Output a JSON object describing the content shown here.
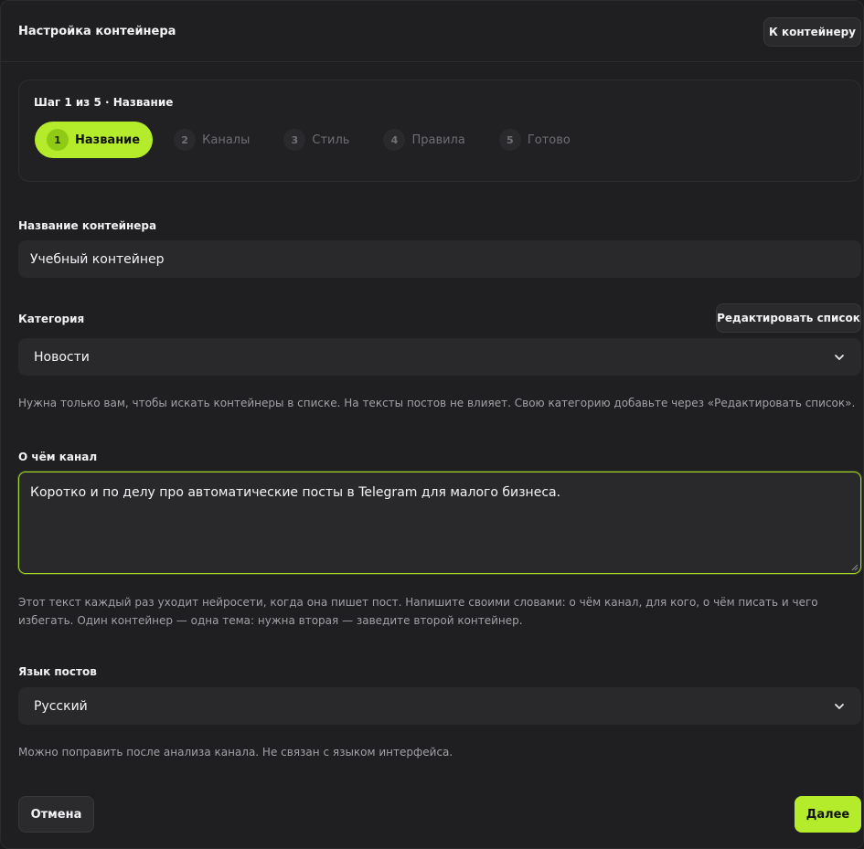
{
  "header": {
    "title": "Настройка контейнера",
    "back_button": "К контейнеру"
  },
  "stepper": {
    "title": "Шаг 1 из 5 · Название",
    "steps": [
      {
        "num": "1",
        "label": "Название"
      },
      {
        "num": "2",
        "label": "Каналы"
      },
      {
        "num": "3",
        "label": "Стиль"
      },
      {
        "num": "4",
        "label": "Правила"
      },
      {
        "num": "5",
        "label": "Готово"
      }
    ],
    "active_step": 1
  },
  "name_field": {
    "label": "Название контейнера",
    "value": "Учебный контейнер"
  },
  "category": {
    "label": "Категория",
    "edit_button": "Редактировать список",
    "selected": "Новости",
    "hint": "Нужна только вам, чтобы искать контейнеры в списке. На тексты постов не влияет. Свою категорию добавьте через «Редактировать список»."
  },
  "about": {
    "label": "О чём канал",
    "value": "Коротко и по делу про автоматические посты в Telegram для малого бизнеса.",
    "hint": "Этот текст каждый раз уходит нейросети, когда она пишет пост. Напишите своими словами: о чём канал, для кого, о чём писать и чего избегать. Один контейнер — одна тема: нужна вторая — заведите второй контейнер."
  },
  "language": {
    "label": "Язык постов",
    "selected": "Русский",
    "hint": "Можно поправить после анализа канала. Не связан с языком интерфейса."
  },
  "footer": {
    "cancel": "Отмена",
    "next": "Далее"
  },
  "colors": {
    "accent": "#b4ec2c",
    "background": "#1f1f21",
    "field": "#29292c"
  }
}
